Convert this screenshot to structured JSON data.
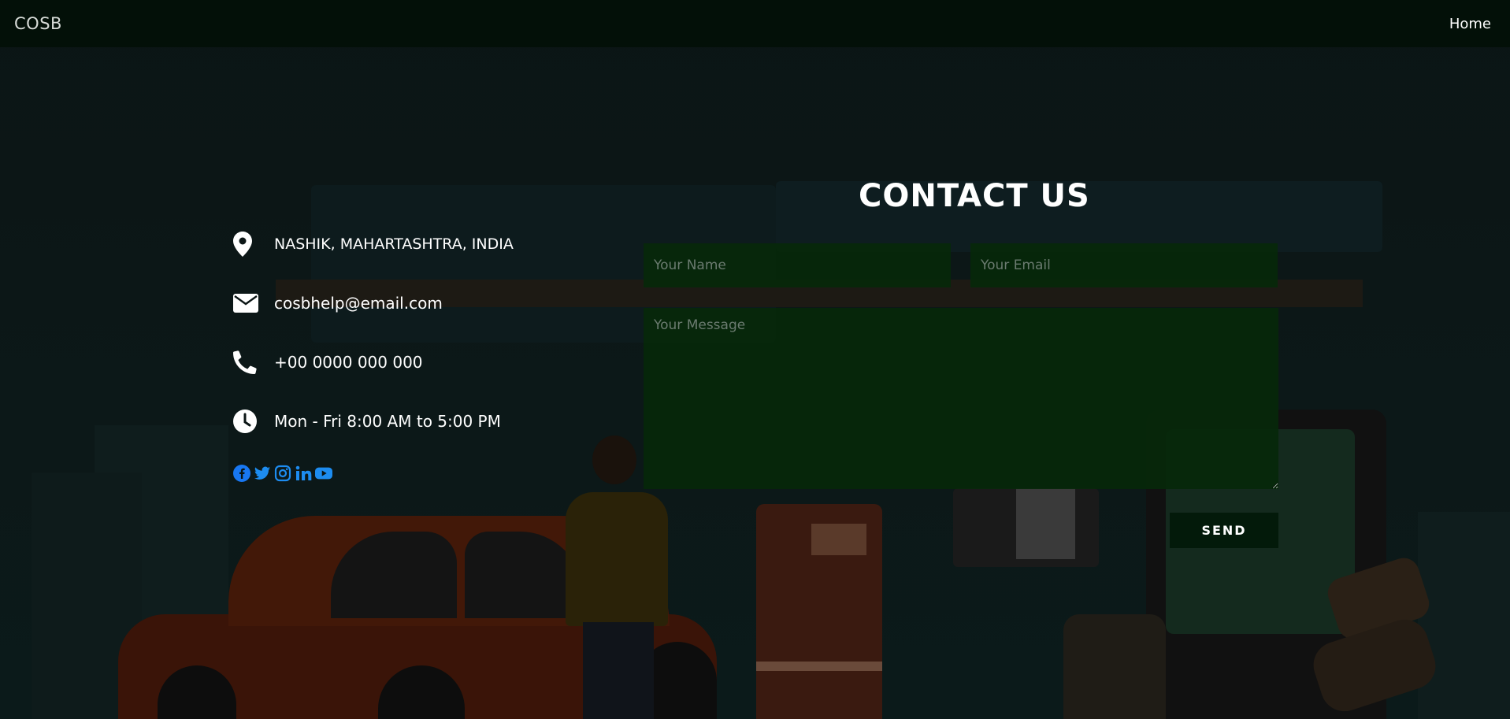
{
  "navbar": {
    "brand": "COSB",
    "home_label": "Home"
  },
  "contact": {
    "title": "CONTACT US",
    "address": "NASHIK, MAHARTASHTRA, INDIA",
    "email": "cosbhelp@email.com",
    "phone": "+00 0000 000 000",
    "hours": "Mon - Fri 8:00 AM to 5:00 PM",
    "social_icons": [
      "facebook-icon",
      "twitter-icon",
      "instagram-icon",
      "linkedin-icon",
      "youtube-icon"
    ],
    "social_color": "#1877f2"
  },
  "form": {
    "name_placeholder": "Your Name",
    "email_placeholder": "Your Email",
    "message_placeholder": "Your Message",
    "send_label": "SEND"
  }
}
